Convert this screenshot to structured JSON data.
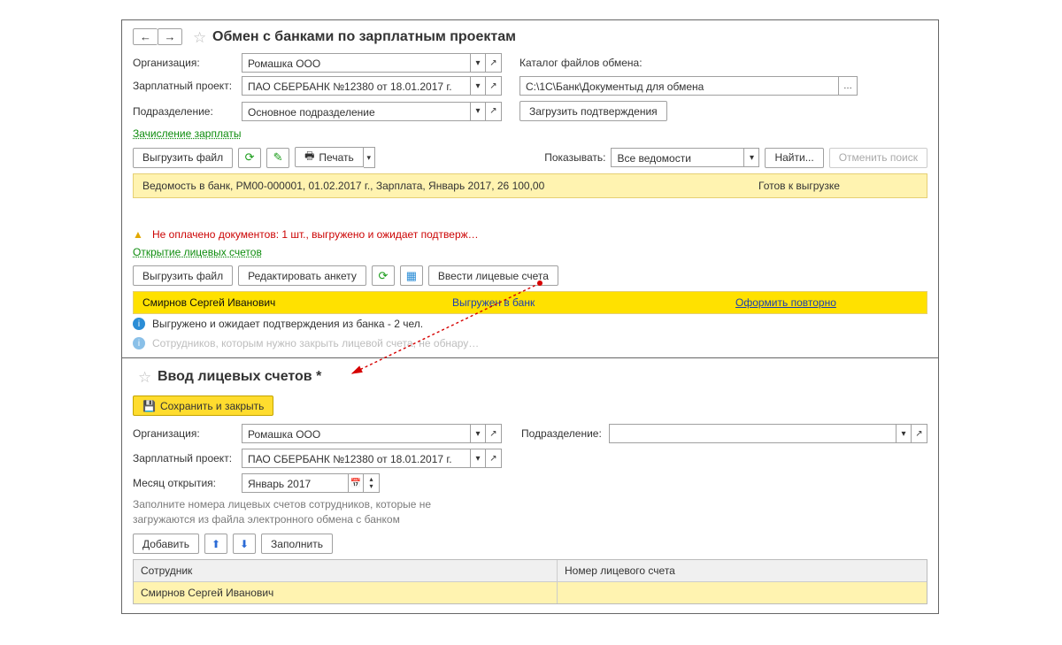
{
  "top": {
    "title": "Обмен с банками по зарплатным проектам",
    "org_label": "Организация:",
    "org_value": "Ромашка ООО",
    "proj_label": "Зарплатный проект:",
    "proj_value": "ПАО СБЕРБАНК №12380    от 18.01.2017 г.",
    "dept_label": "Подразделение:",
    "dept_value": "Основное подразделение",
    "catalog_label": "Каталог файлов обмена:",
    "catalog_value": "C:\\1С\\Банк\\Документыд для обмена",
    "load_confirm": "Загрузить подтверждения",
    "section1": "Зачисление зарплаты",
    "export": "Выгрузить файл",
    "print": "Печать",
    "show_label": "Показывать:",
    "show_value": "Все ведомости",
    "find": "Найти...",
    "cancel_find": "Отменить поиск",
    "strip_text": "Ведомость в банк, РМ00-000001, 01.02.2017 г., Зарплата, Январь 2017, 26 100,00",
    "strip_status": "Готов к выгрузке",
    "warn_text": "Не оплачено документов: 1 шт., выгружено и ожидает подтверж…",
    "section2": "Открытие лицевых счетов",
    "edit_form": "Редактировать анкету",
    "enter_accounts": "Ввести лицевые счета",
    "row_name": "Смирнов Сергей Иванович",
    "row_status": "Выгружен в банк",
    "row_action": "Оформить повторно",
    "info1": "Выгружено и ожидает подтверждения из банка - 2 чел.",
    "info2": "Сотрудников, которым нужно закрыть лицевой счета, не обнару…"
  },
  "bottom": {
    "title": "Ввод лицевых счетов *",
    "save_close": "Сохранить и закрыть",
    "org_label": "Организация:",
    "org_value": "Ромашка ООО",
    "dept_label": "Подразделение:",
    "dept_value": "",
    "proj_label": "Зарплатный проект:",
    "proj_value": "ПАО СБЕРБАНК №12380    от 18.01.2017 г.",
    "month_label": "Месяц открытия:",
    "month_value": "Январь 2017",
    "help1": "Заполните номера лицевых счетов сотрудников, которые не",
    "help2": "загружаются из файла электронного обмена с банком",
    "add": "Добавить",
    "fill": "Заполнить",
    "col1": "Сотрудник",
    "col2": "Номер лицевого счета",
    "row_name": "Смирнов Сергей Иванович"
  }
}
